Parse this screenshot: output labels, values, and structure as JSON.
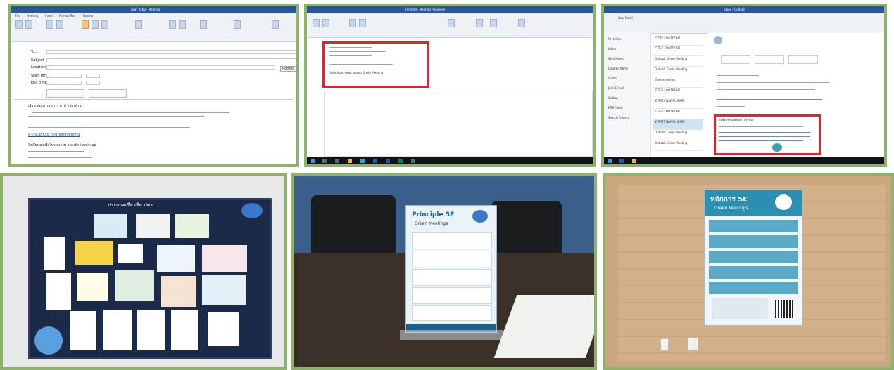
{
  "panels": {
    "outlook_meeting": {
      "window_title": "ตั้งค่า 2560 - Meeting",
      "tabs": [
        "File",
        "Meeting",
        "Insert",
        "Format Text",
        "Review"
      ],
      "to_label": "To...",
      "subject_label": "Subject",
      "location_label": "Location",
      "start_label": "Start time",
      "end_label": "End time",
      "rooms_button": "Rooms...",
      "greeting": "เรียน  คณะกรรมการ สรุป ฯ ทุกท่าน",
      "link_text": "e-line.ptt.co.th/greenmeeting",
      "closing": "จึงเรียนมาเพื่อโปรดทราบ และเข้าร่วมประชุม"
    },
    "outlook_response": {
      "window_title": "Untitled - Meeting Response",
      "note_text": "ได้รับเชิญประชุมผ่านระบบ Green Meeting"
    },
    "outlook_inbox": {
      "window_title": "Inbox - Outlook",
      "new_email_button": "New Email",
      "folders": [
        "Favorites",
        "Inbox",
        "Sent Items",
        "Deleted Items",
        "Drafts",
        "Junk E-mail",
        "Outbox",
        "RSS Feeds",
        "Search Folders"
      ],
      "mail_items": [
        "PTTEP FOOTPRINT",
        "PTTEP FOOTPRINT",
        "Outlook Green Meeting",
        "Outlook Green Meeting",
        "Greenmeeting",
        "PTTEP FOOTPRINT",
        "STARTS NAWAL SMPE",
        "PTTEP FOOTPRINT",
        "STARTS NAWAL SMPE",
        "Outlook Green Meeting",
        "Outlook Green Meeting"
      ],
      "signature_heading": "ลงชื่อประชุมหลังการประชุม"
    },
    "bulletin_board": {
      "heading": "ประกาศเขียวทีม ปตท."
    },
    "table_tent": {
      "title": "Principle 5E",
      "subtitle": "Green Meetings"
    },
    "wall_poster": {
      "title": "หลักการ 5E",
      "subtitle": "Green Meetings"
    }
  },
  "colors": {
    "panel_border": "#8cb369",
    "highlight": "#e0242d",
    "outlook_blue": "#2b579a",
    "board_navy": "#1c2a4a",
    "poster_teal": "#2a8fb3"
  }
}
